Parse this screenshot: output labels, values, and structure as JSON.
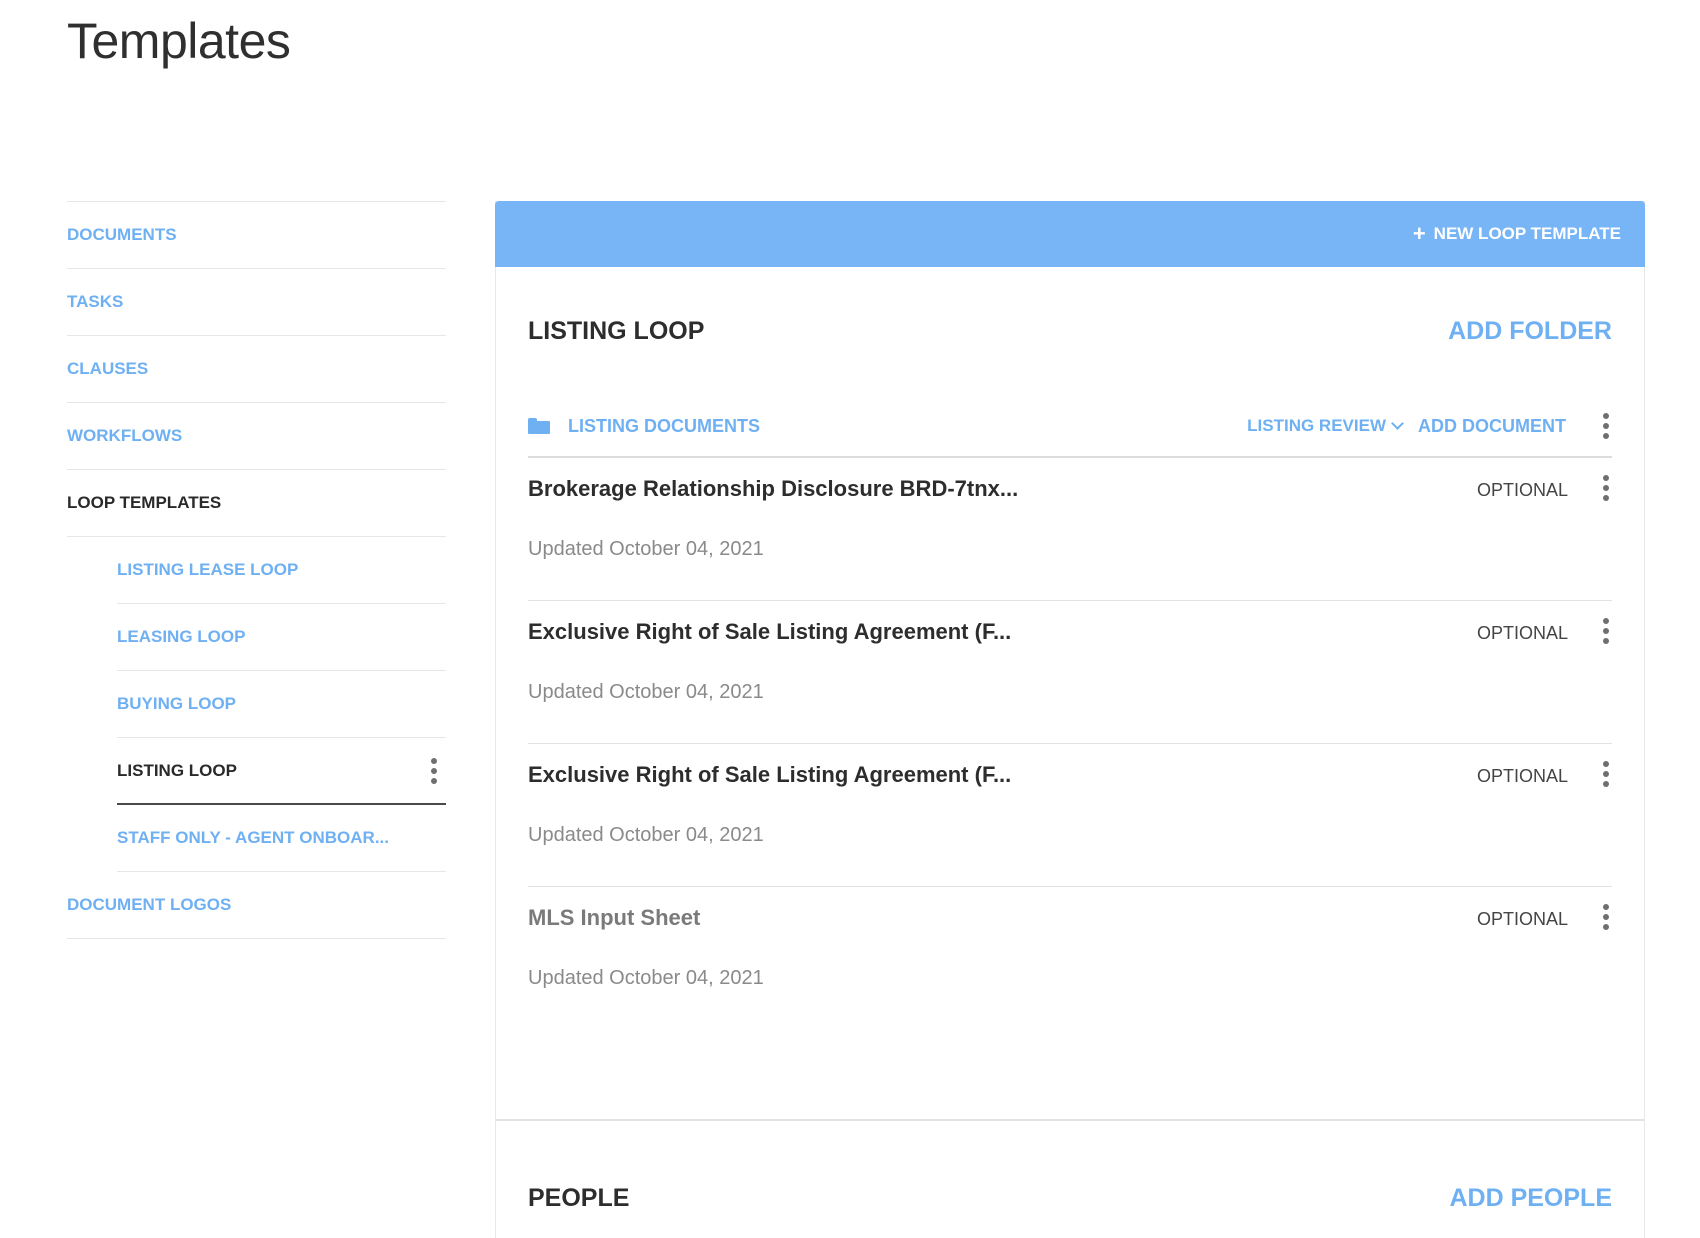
{
  "page": {
    "title": "Templates"
  },
  "sidebar": {
    "items": [
      {
        "label": "DOCUMENTS"
      },
      {
        "label": "TASKS"
      },
      {
        "label": "CLAUSES"
      },
      {
        "label": "WORKFLOWS"
      },
      {
        "label": "LOOP TEMPLATES"
      },
      {
        "label": "LISTING LEASE LOOP"
      },
      {
        "label": "LEASING LOOP"
      },
      {
        "label": "BUYING LOOP"
      },
      {
        "label": "LISTING LOOP"
      },
      {
        "label": "STAFF ONLY - AGENT ONBOAR..."
      },
      {
        "label": "DOCUMENT LOGOS"
      }
    ],
    "more_icon": "kebab-vertical-icon"
  },
  "header": {
    "new_template_label": "NEW LOOP TEMPLATE",
    "plus_icon": "plus-icon",
    "accent_color": "#77b5f7"
  },
  "loop": {
    "title": "LISTING LOOP",
    "add_folder_label": "ADD FOLDER"
  },
  "folder": {
    "icon": "folder-icon",
    "name": "LISTING DOCUMENTS",
    "review_label": "LISTING REVIEW",
    "add_document_label": "ADD DOCUMENT"
  },
  "documents": [
    {
      "title": "Brokerage Relationship Disclosure BRD-7tnx...",
      "updated": "Updated October 04, 2021",
      "status": "OPTIONAL"
    },
    {
      "title": "Exclusive Right of Sale Listing Agreement (F...",
      "updated": "Updated October 04, 2021",
      "status": "OPTIONAL"
    },
    {
      "title": "Exclusive Right of Sale Listing Agreement (F...",
      "updated": "Updated October 04, 2021",
      "status": "OPTIONAL"
    },
    {
      "title": "MLS Input Sheet",
      "updated": "Updated October 04, 2021",
      "status": "OPTIONAL"
    }
  ],
  "people": {
    "title": "PEOPLE",
    "add_people_label": "ADD PEOPLE"
  }
}
